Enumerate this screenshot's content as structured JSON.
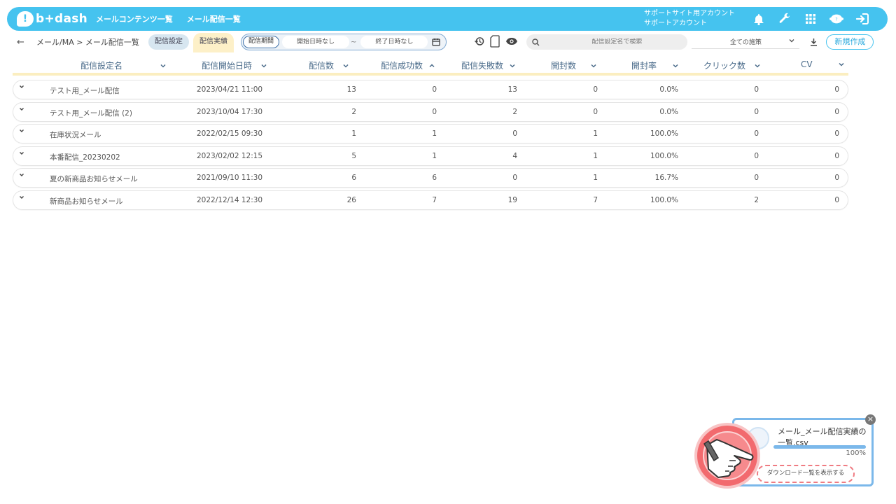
{
  "header": {
    "logo_text": "b+dash",
    "logo_mark": "!",
    "nav": [
      "メールコンテンツ一覧",
      "メール配信一覧"
    ],
    "account_line1": "サポートサイト用アカウント",
    "account_line2": "サポートアカウント",
    "icons": [
      "bell-icon",
      "wrench-icon",
      "apps-grid-icon",
      "support-bot-icon",
      "logout-icon"
    ],
    "bot_badge": "?"
  },
  "subheader": {
    "back": "←",
    "breadcrumb": "メール/MA > メール配信一覧",
    "tab_settings": "配信設定",
    "tab_results": "配信実績",
    "period_label": "配信期間",
    "start_placeholder": "開始日時なし",
    "tilde": "~",
    "end_placeholder": "終了日時なし",
    "search_placeholder": "配信設定名で検索",
    "policy_select": "全ての施策",
    "new_button": "新規作成"
  },
  "table": {
    "columns": [
      "配信設定名",
      "配信開始日時",
      "配信数",
      "配信成功数",
      "配信失敗数",
      "開封数",
      "開封率",
      "クリック数",
      "CV"
    ],
    "rows": [
      [
        "テスト用_メール配信",
        "2023/04/21 11:00",
        "13",
        "0",
        "13",
        "0",
        "0.0%",
        "0",
        "0"
      ],
      [
        "テスト用_メール配信 (2)",
        "2023/10/04 17:30",
        "2",
        "0",
        "2",
        "0",
        "0.0%",
        "0",
        "0"
      ],
      [
        "在庫状況メール",
        "2022/02/15 09:30",
        "1",
        "1",
        "0",
        "1",
        "100.0%",
        "0",
        "0"
      ],
      [
        "本番配信_20230202",
        "2023/02/02 12:15",
        "5",
        "1",
        "4",
        "1",
        "100.0%",
        "0",
        "0"
      ],
      [
        "夏の新商品お知らせメール",
        "2021/09/10 11:30",
        "6",
        "6",
        "0",
        "1",
        "16.7%",
        "0",
        "0"
      ],
      [
        "新商品お知らせメール",
        "2022/12/14 12:30",
        "26",
        "7",
        "19",
        "7",
        "100.0%",
        "2",
        "0"
      ]
    ]
  },
  "download_popup": {
    "file_name": "メール_メール配信実績の一覧.csv",
    "progress": 100,
    "progress_label": "100%",
    "show_list_button": "ダウンロード一覧を表示する",
    "close": "×"
  },
  "colors": {
    "accent": "#45c3ef",
    "tab_active": "#fdf0c8",
    "popup_border": "#7bb8ea",
    "highlight": "#ef7b82"
  }
}
